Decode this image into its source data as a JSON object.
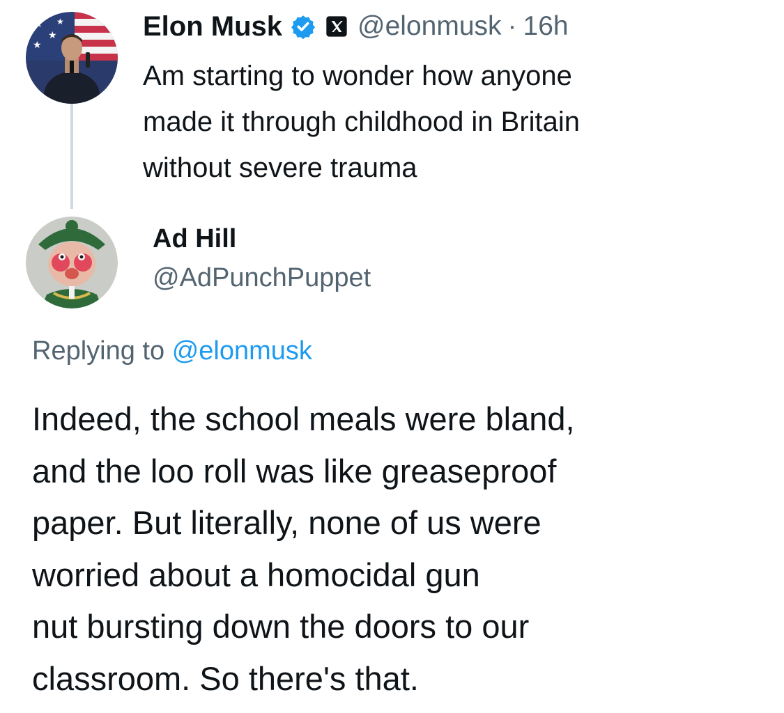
{
  "original_tweet": {
    "author_name": "Elon Musk",
    "handle": "@elonmusk",
    "separator": "·",
    "time": "16h",
    "text": "Am starting to wonder how anyone\nmade it through childhood in Britain\nwithout severe trauma",
    "avatar_icon": "elon-musk-avatar-icon",
    "verified_icon": "verified-badge-icon",
    "affiliate_icon": "x-logo-icon"
  },
  "reply_tweet": {
    "author_name": "Ad Hill",
    "handle": "@AdPunchPuppet",
    "avatar_icon": "ad-hill-avatar-icon",
    "replying_prefix": "Replying to",
    "replying_to": "@elonmusk",
    "text": "Indeed, the school meals were bland,\nand the loo roll was like greaseproof\npaper. But literally, none of us were\nworried about a homocidal gun\nnut bursting down the doors to our\nclassroom. So there's that."
  },
  "colors": {
    "text_primary": "#0f1419",
    "text_secondary": "#536471",
    "link": "#1d9bf0",
    "thread_line": "#cfd9de"
  }
}
